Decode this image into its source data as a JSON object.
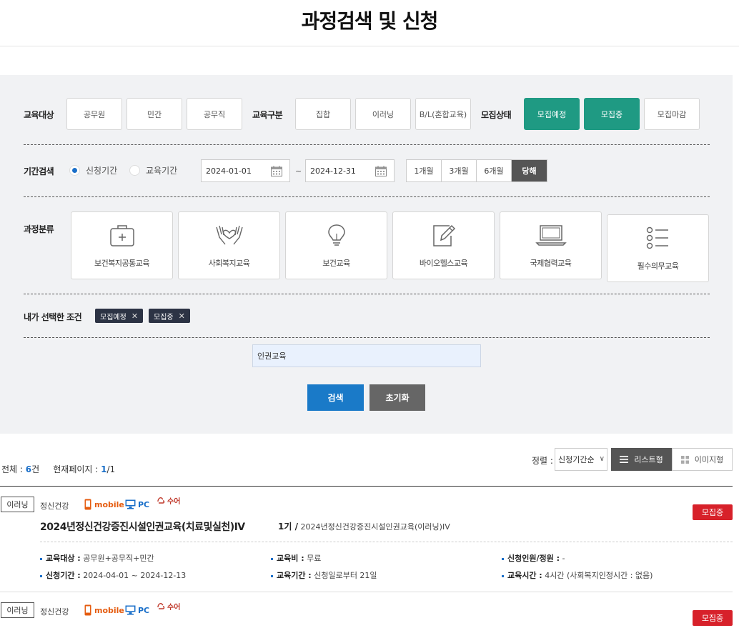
{
  "page_title": "과정검색 및 신청",
  "filters": {
    "target_label": "교육대상",
    "target_options": [
      "공무원",
      "민간",
      "공무직"
    ],
    "type_label": "교육구분",
    "type_options": [
      "집합",
      "이러닝",
      "B/L(혼합교육)"
    ],
    "status_label": "모집상태",
    "status_options": [
      "모집예정",
      "모집중",
      "모집마감"
    ],
    "status_selected": [
      "모집예정",
      "모집중"
    ]
  },
  "period": {
    "label": "기간검색",
    "radio_apply": "신청기간",
    "radio_edu": "교육기간",
    "radio_selected": "신청기간",
    "start_date": "2024-01-01",
    "end_date": "2024-12-31",
    "tilde": "~",
    "quick": [
      "1개월",
      "3개월",
      "6개월",
      "당해"
    ],
    "quick_selected": "당해"
  },
  "categories": {
    "label": "과정분류",
    "items": [
      {
        "label": "보건복지공통교육",
        "icon": "medical-kit-icon"
      },
      {
        "label": "사회복지교육",
        "icon": "hands-heart-icon"
      },
      {
        "label": "보건교육",
        "icon": "lightbulb-icon"
      },
      {
        "label": "바이오헬스교육",
        "icon": "edit-icon"
      },
      {
        "label": "국제협력교육",
        "icon": "laptop-icon"
      },
      {
        "label": "필수의무교육",
        "icon": "list-icon"
      }
    ]
  },
  "selected": {
    "label": "내가 선택한 조건",
    "tags": [
      "모집예정",
      "모집중"
    ]
  },
  "keyword": {
    "value": "인권교육"
  },
  "buttons": {
    "search": "검색",
    "reset": "초기화"
  },
  "results": {
    "total_label": "전체 : ",
    "total": "6",
    "total_unit": "건",
    "page_label": "현재페이지 : ",
    "page": "1",
    "page_total": "/1",
    "sort_label": "정렬 :",
    "sort_value": "신청기간순",
    "view_list": "리스트형",
    "view_image": "이미지형"
  },
  "courses": [
    {
      "type": "이러닝",
      "category": "정신건강",
      "mobile": "mobile",
      "pc": "PC",
      "sign": "수어",
      "status": "모집중",
      "title": "2024년정신건강증진시설인권교육(치료및실천)IV",
      "session_no": "1기 /",
      "session_name": "2024년정신건강증진시설인권교육(이러닝)IV",
      "info": {
        "target_k": "교육대상 :",
        "target_v": "공무원+공무직+민간",
        "fee_k": "교육비 :",
        "fee_v": "무료",
        "capacity_k": "신청인원/정원 :",
        "capacity_v": "-",
        "apply_k": "신청기간 :",
        "apply_v": "2024-04-01 ~ 2024-12-13",
        "period_k": "교육기간 :",
        "period_v": "신청일로부터 21일",
        "hours_k": "교육시간 :",
        "hours_v": "4시간 (사회복지인정시간 : 없음)"
      }
    },
    {
      "type": "이러닝",
      "category": "정신건강",
      "mobile": "mobile",
      "pc": "PC",
      "sign": "수어",
      "status": "모집중"
    }
  ],
  "colors": {
    "accent": "#1f9a83",
    "primary": "#1a7ac8",
    "status_red": "#d7212a",
    "tag_bg": "#2c3344"
  }
}
